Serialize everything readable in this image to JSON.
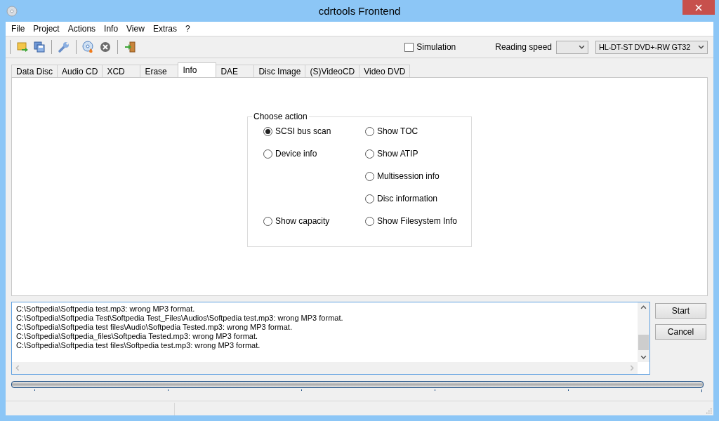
{
  "window": {
    "title": "cdrtools Frontend"
  },
  "menu": [
    "File",
    "Project",
    "Actions",
    "Info",
    "View",
    "Extras",
    "?"
  ],
  "toolbar": {
    "simulation": {
      "label": "Simulation",
      "checked": false
    },
    "reading_speed": {
      "label": "Reading speed"
    },
    "drive": {
      "value": "HL-DT-ST DVD+-RW GT32"
    }
  },
  "tabs": [
    {
      "label": "Data Disc",
      "selected": false
    },
    {
      "label": "Audio CD",
      "selected": false
    },
    {
      "label": "XCD",
      "selected": false
    },
    {
      "label": "Erase",
      "selected": false
    },
    {
      "label": "Info",
      "selected": true
    },
    {
      "label": "DAE",
      "selected": false
    },
    {
      "label": "Disc Image",
      "selected": false
    },
    {
      "label": "(S)VideoCD",
      "selected": false
    },
    {
      "label": "Video DVD",
      "selected": false
    }
  ],
  "choose_action": {
    "title": "Choose action",
    "left_options": [
      {
        "label": "SCSI bus scan",
        "selected": true
      },
      {
        "label": "Device info",
        "selected": false
      },
      {
        "label": "Show capacity",
        "selected": false
      }
    ],
    "right_options": [
      {
        "label": "Show TOC",
        "selected": false
      },
      {
        "label": "Show ATIP",
        "selected": false
      },
      {
        "label": "Multisession info",
        "selected": false
      },
      {
        "label": "Disc information",
        "selected": false
      },
      {
        "label": "Show Filesystem Info",
        "selected": false
      }
    ]
  },
  "log": [
    "C:\\Softpedia\\Softpedia test.mp3: wrong MP3 format.",
    "C:\\Softpedia\\Softpedia Test\\Softpedia Test_Files\\Audios\\Softpedia test.mp3: wrong MP3 format.",
    "C:\\Softpedia\\Softpedia test files\\Audio\\Softpedia Tested.mp3: wrong MP3 format.",
    "C:\\Softpedia\\Softpedia_files\\Softpedia Tested.mp3: wrong MP3 format.",
    "C:\\Softpedia\\Softpedia test files\\Softpedia test.mp3: wrong MP3 format."
  ],
  "buttons": [
    "Start",
    "Cancel"
  ]
}
